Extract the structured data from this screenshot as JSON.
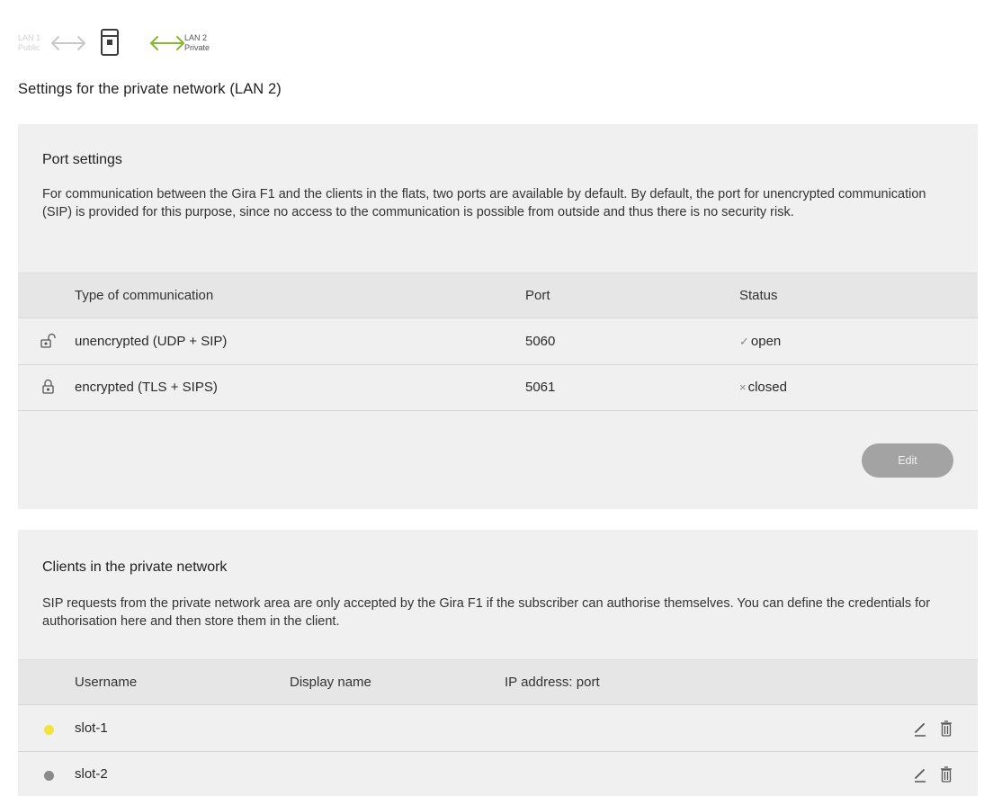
{
  "network_indicator": {
    "lan1": "LAN 1",
    "lan1_sub": "Public",
    "lan2": "LAN 2",
    "lan2_sub": "Private",
    "icons": [
      "double-arrow-icon",
      "device-icon",
      "double-arrow-icon"
    ],
    "colors": {
      "inactive": "#c8c8c8",
      "active": "#86b82f"
    }
  },
  "page_title": "Settings for the private network (LAN 2)",
  "port_settings": {
    "title": "Port settings",
    "description": "For communication between the Gira F1 and the clients in the flats, two ports are available by default. By default, the port for unencrypted communication (SIP) is provided for this purpose, since no access to the communication is possible from outside and thus there is no security risk.",
    "columns": [
      "Type of communication",
      "Port",
      "Status"
    ],
    "rows": [
      {
        "icon": "unlocked-padlock-icon",
        "type": "unencrypted (UDP + SIP)",
        "port": "5060",
        "status_mark": "✓",
        "status": "open"
      },
      {
        "icon": "locked-padlock-icon",
        "type": "encrypted (TLS + SIPS)",
        "port": "5061",
        "status_mark": "×",
        "status": "closed"
      }
    ],
    "edit_label": "Edit"
  },
  "clients": {
    "title": "Clients in the private network",
    "description": "SIP requests from the private network area are only accepted by the Gira F1 if the subscriber can authorise themselves. You can define the credentials for authorisation here and then store them in the client.",
    "columns": [
      "Username",
      "Display name",
      "IP address: port"
    ],
    "rows": [
      {
        "status_color": "#f3e33b",
        "username": "slot-1",
        "display_name": "",
        "ip_port": ""
      },
      {
        "status_color": "#8a8a8a",
        "username": "slot-2",
        "display_name": "",
        "ip_port": ""
      }
    ],
    "row_icons": [
      "pencil-icon",
      "trash-icon"
    ]
  }
}
